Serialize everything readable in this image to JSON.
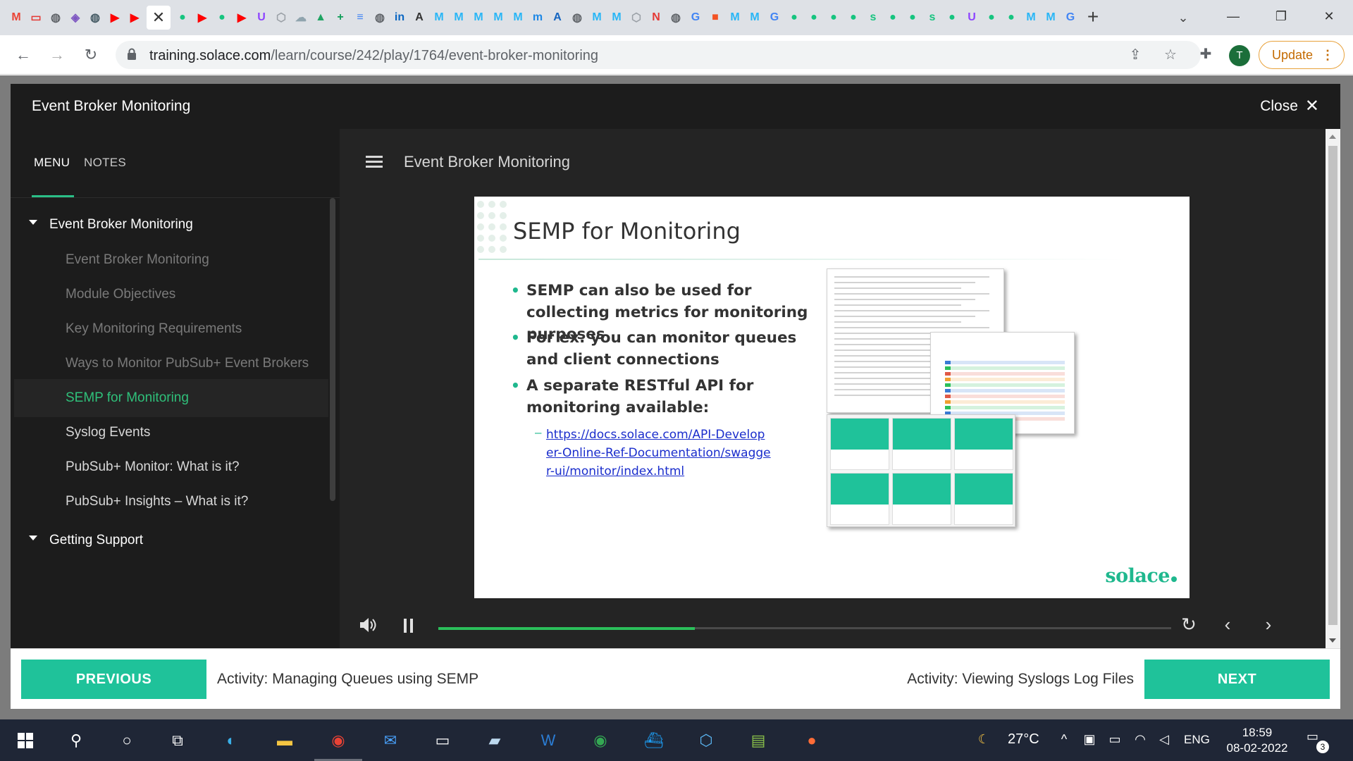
{
  "browser": {
    "tab_favicons": [
      {
        "name": "gmail-tab-icon",
        "glyph": "M",
        "color": "#ea4335"
      },
      {
        "name": "red-app-tab-icon",
        "glyph": "▭",
        "color": "#e53935"
      },
      {
        "name": "globe-tab-icon",
        "glyph": "◍",
        "color": "#5f6368"
      },
      {
        "name": "puzzle-tab-icon",
        "glyph": "◈",
        "color": "#7e57c2"
      },
      {
        "name": "globe-tab-icon",
        "glyph": "◍",
        "color": "#455a64"
      },
      {
        "name": "youtube-tab-icon",
        "glyph": "▶",
        "color": "#ff0000"
      },
      {
        "name": "youtube-tab-icon",
        "glyph": "▶",
        "color": "#ff0000"
      },
      {
        "name": "green-tab-icon",
        "glyph": "●",
        "color": "#16c47f"
      },
      {
        "name": "youtube-tab-icon",
        "glyph": "▶",
        "color": "#ff0000"
      },
      {
        "name": "green-tab-icon",
        "glyph": "●",
        "color": "#16c47f"
      },
      {
        "name": "youtube-tab-icon",
        "glyph": "▶",
        "color": "#ff0000"
      },
      {
        "name": "shield-tab-icon",
        "glyph": "U",
        "color": "#8e44ff"
      },
      {
        "name": "hex-tab-icon",
        "glyph": "⬡",
        "color": "#9aa0a6"
      },
      {
        "name": "cloud-tab-icon",
        "glyph": "☁",
        "color": "#90a4ae"
      },
      {
        "name": "drive-tab-icon",
        "glyph": "▲",
        "color": "#1fa463"
      },
      {
        "name": "sheets-tab-icon",
        "glyph": "+",
        "color": "#0f9d58"
      },
      {
        "name": "docs-tab-icon",
        "glyph": "≡",
        "color": "#4285f4"
      },
      {
        "name": "globe-tab-icon",
        "glyph": "◍",
        "color": "#5f6368"
      },
      {
        "name": "linkedin-tab-icon",
        "glyph": "in",
        "color": "#0a66c2"
      },
      {
        "name": "amc-tab-icon",
        "glyph": "A",
        "color": "#333333"
      },
      {
        "name": "m-tab-icon",
        "glyph": "M",
        "color": "#29b6f6"
      },
      {
        "name": "m-tab-icon",
        "glyph": "M",
        "color": "#29b6f6"
      },
      {
        "name": "m-tab-icon",
        "glyph": "M",
        "color": "#29b6f6"
      },
      {
        "name": "m-tab-icon",
        "glyph": "M",
        "color": "#29b6f6"
      },
      {
        "name": "m-tab-icon",
        "glyph": "M",
        "color": "#29b6f6"
      },
      {
        "name": "mvn-tab-icon",
        "glyph": "m",
        "color": "#1e88e5"
      },
      {
        "name": "a-tab-icon",
        "glyph": "A",
        "color": "#1565c0"
      },
      {
        "name": "globe-tab-icon",
        "glyph": "◍",
        "color": "#5f6368"
      },
      {
        "name": "m-tab-icon",
        "glyph": "M",
        "color": "#29b6f6"
      },
      {
        "name": "m-tab-icon",
        "glyph": "M",
        "color": "#29b6f6"
      },
      {
        "name": "hex-tab-icon",
        "glyph": "⬡",
        "color": "#9aa0a6"
      },
      {
        "name": "notion-tab-icon",
        "glyph": "N",
        "color": "#e53935"
      },
      {
        "name": "globe-tab-icon",
        "glyph": "◍",
        "color": "#5f6368"
      },
      {
        "name": "google-tab-icon",
        "glyph": "G",
        "color": "#4285f4"
      },
      {
        "name": "microsoft-tab-icon",
        "glyph": "■",
        "color": "#f35325"
      },
      {
        "name": "m-tab-icon",
        "glyph": "M",
        "color": "#29b6f6"
      },
      {
        "name": "m-tab-icon",
        "glyph": "M",
        "color": "#29b6f6"
      },
      {
        "name": "google-tab-icon",
        "glyph": "G",
        "color": "#4285f4"
      },
      {
        "name": "green-tab-icon",
        "glyph": "●",
        "color": "#16c47f"
      },
      {
        "name": "green-tab-icon",
        "glyph": "●",
        "color": "#16c47f"
      },
      {
        "name": "green-tab-icon",
        "glyph": "●",
        "color": "#16c47f"
      },
      {
        "name": "green-tab-icon",
        "glyph": "●",
        "color": "#16c47f"
      },
      {
        "name": "solace-tab-icon",
        "glyph": "s",
        "color": "#16c47f"
      },
      {
        "name": "green-tab-icon",
        "glyph": "●",
        "color": "#16c47f"
      },
      {
        "name": "green-tab-icon",
        "glyph": "●",
        "color": "#16c47f"
      },
      {
        "name": "solace-tab-icon",
        "glyph": "s",
        "color": "#16c47f"
      },
      {
        "name": "green-tab-icon",
        "glyph": "●",
        "color": "#16c47f"
      },
      {
        "name": "shield-tab-icon",
        "glyph": "U",
        "color": "#8e44ff"
      },
      {
        "name": "green-tab-icon",
        "glyph": "●",
        "color": "#16c47f"
      },
      {
        "name": "green-tab-icon",
        "glyph": "●",
        "color": "#16c47f"
      },
      {
        "name": "m-tab-icon",
        "glyph": "M",
        "color": "#29b6f6"
      },
      {
        "name": "m-tab-icon",
        "glyph": "M",
        "color": "#29b6f6"
      },
      {
        "name": "google-tab-icon",
        "glyph": "G",
        "color": "#4285f4"
      }
    ],
    "active_tab_close": "✕",
    "new_tab": "+",
    "url_host": "training.solace.com",
    "url_path": "/learn/course/242/play/1764/event-broker-monitoring",
    "profile_initial": "T",
    "update_label": "Update"
  },
  "player": {
    "header_title": "Event Broker Monitoring",
    "close_label": "Close",
    "sidebar_tabs": {
      "menu": "MENU",
      "notes": "NOTES"
    },
    "sections": [
      {
        "title": "Event Broker Monitoring",
        "items": [
          {
            "label": "Event Broker Monitoring",
            "state": "done"
          },
          {
            "label": "Module Objectives",
            "state": "done"
          },
          {
            "label": "Key Monitoring Requirements",
            "state": "done"
          },
          {
            "label": "Ways to Monitor PubSub+ Event Brokers",
            "state": "done"
          },
          {
            "label": "SEMP for Monitoring",
            "state": "current"
          },
          {
            "label": "Syslog Events",
            "state": "pending"
          },
          {
            "label": "PubSub+ Monitor: What is it?",
            "state": "pending"
          },
          {
            "label": "PubSub+ Insights – What is it?",
            "state": "pending"
          }
        ]
      },
      {
        "title": "Getting Support",
        "items": []
      }
    ],
    "content_title": "Event Broker Monitoring",
    "slide": {
      "title": "SEMP for Monitoring",
      "bullets": [
        "SEMP can also be used for collecting metrics for monitoring purposes",
        "For ex. you can monitor queues and client connections",
        "A separate RESTful API for monitoring available:"
      ],
      "link": "https://docs.solace.com/API-Developer-Online-Ref-Documentation/swagger-ui/monitor/index.html",
      "logo": "solace"
    },
    "progress_fraction": 0.35,
    "footer": {
      "previous_label": "PREVIOUS",
      "previous_title": "Activity: Managing Queues using SEMP",
      "next_label": "NEXT",
      "next_title": "Activity: Viewing Syslogs Log Files"
    }
  },
  "taskbar": {
    "weather": "27°C",
    "language": "ENG",
    "time": "18:59",
    "date": "08-02-2022",
    "notification_count": "3"
  },
  "colors": {
    "accent_green": "#1fc29a",
    "current_item_green": "#2fc07a",
    "progress_green": "#2bbf5a",
    "link_blue": "#1a2dcc"
  }
}
